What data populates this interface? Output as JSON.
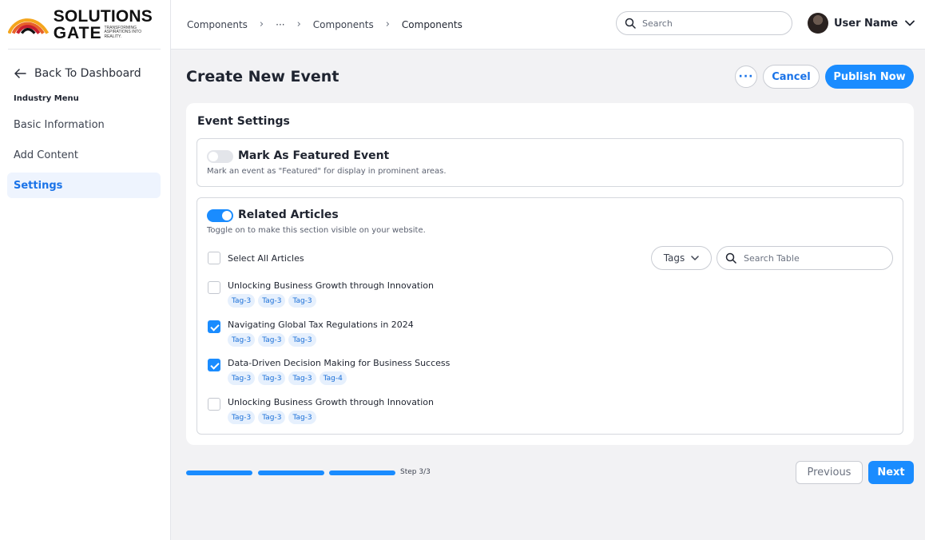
{
  "brand": {
    "name_line1": "SOLUTIONS",
    "name_line2": "GATE",
    "tagline": "TRANSFORMING ASPIRATIONS INTO REALITY."
  },
  "sidebar": {
    "back_label": "Back To Dashboard",
    "menu_title": "Industry Menu",
    "items": [
      {
        "label": "Basic Information",
        "active": false
      },
      {
        "label": "Add Content",
        "active": false
      },
      {
        "label": "Settings",
        "active": true
      }
    ]
  },
  "header": {
    "breadcrumb": [
      "Components",
      "···",
      "Components",
      "Components"
    ],
    "search_placeholder": "Search",
    "user_name": "User Name"
  },
  "page": {
    "title": "Create New Event",
    "more_label": "···",
    "cancel_label": "Cancel",
    "publish_label": "Publish Now"
  },
  "settings": {
    "title": "Event Settings",
    "featured": {
      "heading": "Mark As Featured Event",
      "description": "Mark an event as \"Featured\" for display in prominent areas.",
      "enabled": false
    },
    "related": {
      "heading": "Related Articles",
      "description": "Toggle on to make this section visible on your website.",
      "enabled": true,
      "select_all_label": "Select All Articles",
      "tags_label": "Tags",
      "search_placeholder": "Search Table",
      "articles": [
        {
          "title": "Unlocking Business Growth through Innovation",
          "checked": false,
          "tags": [
            "Tag-3",
            "Tag-3",
            "Tag-3"
          ]
        },
        {
          "title": "Navigating Global Tax Regulations in 2024",
          "checked": true,
          "tags": [
            "Tag-3",
            "Tag-3",
            "Tag-3"
          ]
        },
        {
          "title": "Data-Driven Decision Making for Business Success",
          "checked": true,
          "tags": [
            "Tag-3",
            "Tag-3",
            "Tag-3",
            "Tag-4"
          ]
        },
        {
          "title": "Unlocking Business Growth through Innovation",
          "checked": false,
          "tags": [
            "Tag-3",
            "Tag-3",
            "Tag-3"
          ]
        }
      ]
    }
  },
  "footer": {
    "step_label": "Step 3/3",
    "steps_completed": 3,
    "steps_total": 3,
    "previous_label": "Previous",
    "next_label": "Next"
  },
  "colors": {
    "accent": "#1a8cff",
    "tag_bg": "#e6f0fd",
    "active_nav_bg": "#eef4fe"
  }
}
